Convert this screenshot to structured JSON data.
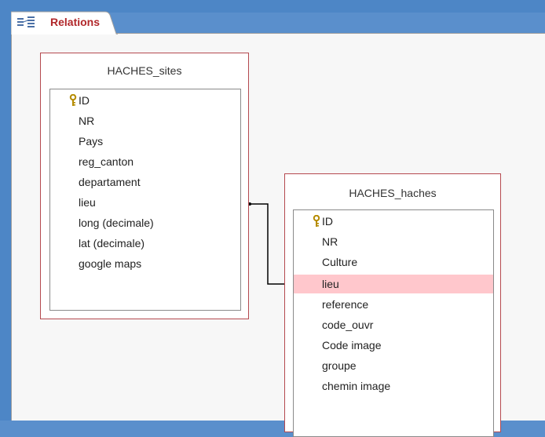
{
  "tab": {
    "label": "Relations",
    "icon": "relationships-icon"
  },
  "tables": [
    {
      "title": "HACHES_sites",
      "fields": [
        {
          "name": "ID",
          "primary_key": true
        },
        {
          "name": "NR"
        },
        {
          "name": "Pays"
        },
        {
          "name": "reg_canton"
        },
        {
          "name": "departament"
        },
        {
          "name": "lieu"
        },
        {
          "name": "long (decimale)"
        },
        {
          "name": "lat (decimale)"
        },
        {
          "name": "google maps"
        }
      ]
    },
    {
      "title": "HACHES_haches",
      "fields": [
        {
          "name": "ID",
          "primary_key": true
        },
        {
          "name": "NR"
        },
        {
          "name": "Culture"
        },
        {
          "name": "lieu",
          "selected": true
        },
        {
          "name": "reference"
        },
        {
          "name": "code_ouvr"
        },
        {
          "name": "Code image"
        },
        {
          "name": "groupe"
        },
        {
          "name": "chemin image"
        }
      ]
    }
  ],
  "relationship": {
    "from": "HACHES_sites.lieu",
    "to": "HACHES_haches.lieu"
  },
  "colors": {
    "tab_label": "#b1272a",
    "table_border": "#b5494f",
    "selected_row": "#ffc7cc",
    "canvas": "#f7f7f7"
  }
}
